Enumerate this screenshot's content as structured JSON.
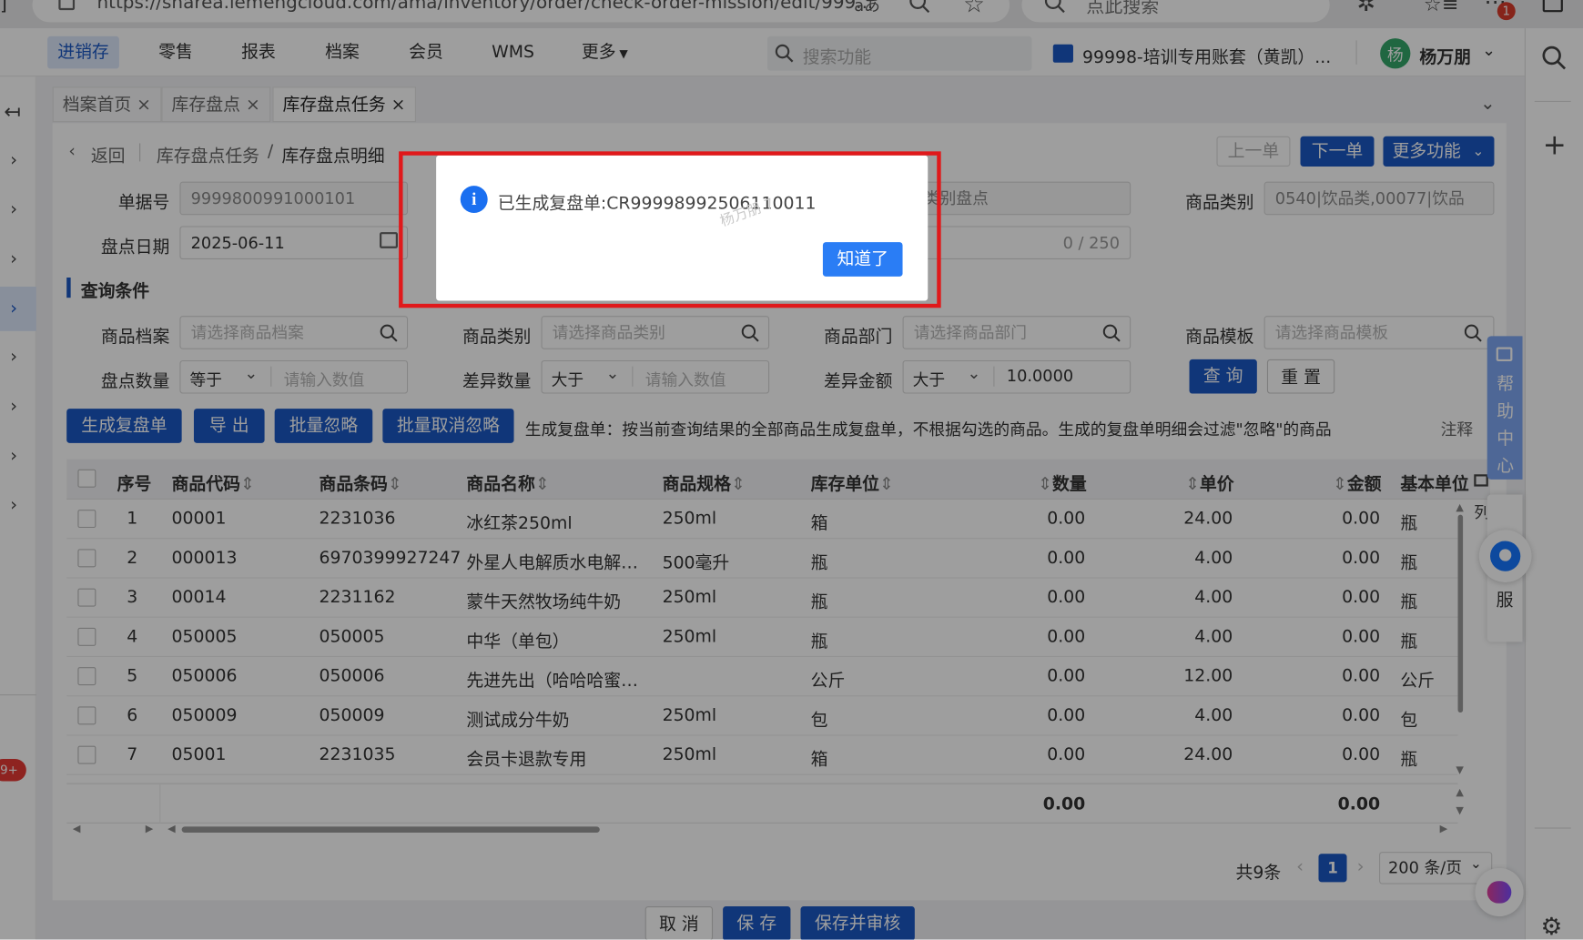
{
  "browser": {
    "url": "https://sharea.lemengcloud.com/ama/inventory/order/check-order-mission/edit/999...",
    "search_placeholder": "点此搜索",
    "badge": "1"
  },
  "nav": {
    "items": [
      "进销存",
      "零售",
      "报表",
      "档案",
      "会员",
      "WMS",
      "更多"
    ],
    "search_placeholder": "搜索功能",
    "account": "99998-培训专用账套（黄凯）...",
    "avatar_char": "杨",
    "user": "杨万朋"
  },
  "tabs": [
    {
      "label": "档案首页"
    },
    {
      "label": "库存盘点"
    },
    {
      "label": "库存盘点任务"
    }
  ],
  "breadcrumb": {
    "back": "返回",
    "parent": "库存盘点任务",
    "sep": "/",
    "current": "库存盘点明细"
  },
  "top_buttons": {
    "prev": "上一单",
    "next": "下一单",
    "more": "更多功能"
  },
  "form": {
    "order_no_label": "单据号",
    "order_no": "9999800991000101",
    "type_value": "类别盘点",
    "category_label": "商品类别",
    "category_value": "0540|饮品类,00077|饮品",
    "date_label": "盘点日期",
    "date_value": "2025-06-11",
    "remark_count": "0 / 250"
  },
  "query": {
    "section_title": "查询条件",
    "product_label": "商品档案",
    "product_placeholder": "请选择商品档案",
    "ptype_label": "商品类别",
    "ptype_placeholder": "请选择商品类别",
    "dept_label": "商品部门",
    "dept_placeholder": "请选择商品部门",
    "tpl_label": "商品模板",
    "tpl_placeholder": "请选择商品模板",
    "count_label": "盘点数量",
    "count_op": "等于",
    "count_placeholder": "请输入数值",
    "diff_label": "差异数量",
    "diff_op": "大于",
    "diff_placeholder": "请输入数值",
    "amt_label": "差异金额",
    "amt_op": "大于",
    "amt_value": "10.0000",
    "search_btn": "查 询",
    "reset_btn": "重 置"
  },
  "actions": {
    "gen": "生成复盘单",
    "export": "导 出",
    "ignore": "批量忽略",
    "unignore": "批量取消忽略",
    "hint": "生成复盘单：按当前查询结果的全部商品生成复盘单，不根据勾选的商品。生成的复盘单明细会过滤\"忽略\"的商品",
    "note": "注释"
  },
  "table": {
    "columns": [
      "序号",
      "商品代码",
      "商品条码",
      "商品名称",
      "商品规格",
      "库存单位",
      "数量",
      "单价",
      "金额",
      "基本单位"
    ],
    "rows": [
      [
        "1",
        "00001",
        "2231036",
        "冰红茶250ml",
        "250ml",
        "箱",
        "0.00",
        "24.00",
        "0.00",
        "瓶"
      ],
      [
        "2",
        "000013",
        "6970399927247",
        "外星人电解质水电解…",
        "500毫升",
        "瓶",
        "0.00",
        "4.00",
        "0.00",
        "瓶"
      ],
      [
        "3",
        "00014",
        "2231162",
        "蒙牛天然牧场纯牛奶",
        "250ml",
        "瓶",
        "0.00",
        "4.00",
        "0.00",
        "瓶"
      ],
      [
        "4",
        "050005",
        "050005",
        "中华（单包）",
        "250ml",
        "瓶",
        "0.00",
        "4.00",
        "0.00",
        "瓶"
      ],
      [
        "5",
        "050006",
        "050006",
        "先进先出（哈哈哈蜜…",
        "",
        "公斤",
        "0.00",
        "12.00",
        "0.00",
        "公斤"
      ],
      [
        "6",
        "050009",
        "050009",
        "测试成分牛奶",
        "250ml",
        "包",
        "0.00",
        "4.00",
        "0.00",
        "包"
      ],
      [
        "7",
        "05001",
        "2231035",
        "会员卡退款专用",
        "250ml",
        "箱",
        "0.00",
        "24.00",
        "0.00",
        "瓶"
      ]
    ],
    "total_qty": "0.00",
    "total_amt": "0.00",
    "col_setting": "列"
  },
  "pagination": {
    "total": "共9条",
    "page": "1",
    "size": "200 条/页"
  },
  "footer": {
    "cancel": "取 消",
    "save": "保 存",
    "save_audit": "保存并审核"
  },
  "help": {
    "label": "帮助中心",
    "service": "服"
  },
  "left_badge": "9+",
  "dialog": {
    "message": "已生成复盘单:CR99998992506110011",
    "watermark": "杨万朋 7",
    "ok": "知道了"
  }
}
